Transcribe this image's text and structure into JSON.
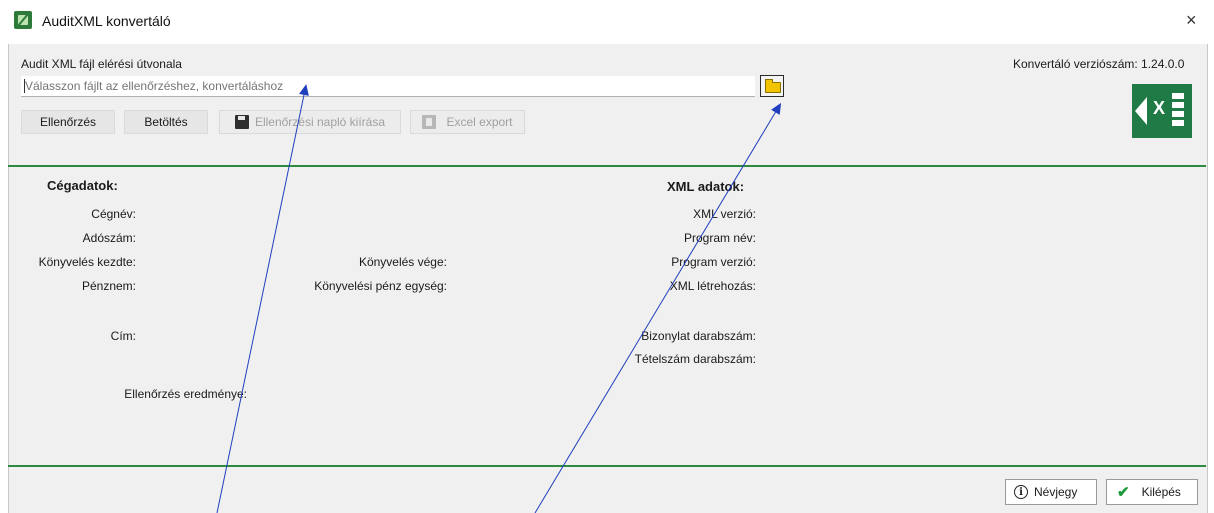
{
  "window": {
    "title": "AuditXML konvertáló",
    "close_symbol": "×"
  },
  "header": {
    "path_label": "Audit XML fájl elérési útvonala",
    "path_placeholder": "Válasszon fájlt az ellenőrzéshez, konvertáláshoz",
    "version_text": "Konvertáló verziószám: 1.24.0.0"
  },
  "toolbar": {
    "check_label": "Ellenőrzés",
    "load_label": "Betöltés",
    "write_log_label": "Ellenőrzési napló kiírása",
    "excel_export_label": "Excel export"
  },
  "company": {
    "heading": "Cégadatok:",
    "name_label": "Cégnév:",
    "tax_label": "Adószám:",
    "start_label": "Könyvelés kezdte:",
    "end_label": "Könyvelés vége:",
    "currency_label": "Pénznem:",
    "unit_label": "Könyvelési pénz egység:",
    "address_label": "Cím:",
    "result_label": "Ellenőrzés eredménye:"
  },
  "xml": {
    "heading": "XML adatok:",
    "version_label": "XML verzió:",
    "program_name_label": "Program név:",
    "program_version_label": "Program verzió:",
    "created_label": "XML létrehozás:",
    "doc_count_label": "Bizonylat darabszám:",
    "item_count_label": "Tételszám darabszám:"
  },
  "footer": {
    "about_label": "Névjegy",
    "exit_label": "Kilépés"
  },
  "icons": {
    "app": "app-icon",
    "browse": "folder-icon",
    "save": "floppy-icon",
    "excel_small": "excel-icon",
    "excel_logo": "excel-logo",
    "about": "info-icon",
    "exit": "checkmark-icon"
  },
  "colors": {
    "separator": "#2d8a3e",
    "excel_green": "#1f7a45",
    "annotation_line": "#1f3fbf"
  }
}
